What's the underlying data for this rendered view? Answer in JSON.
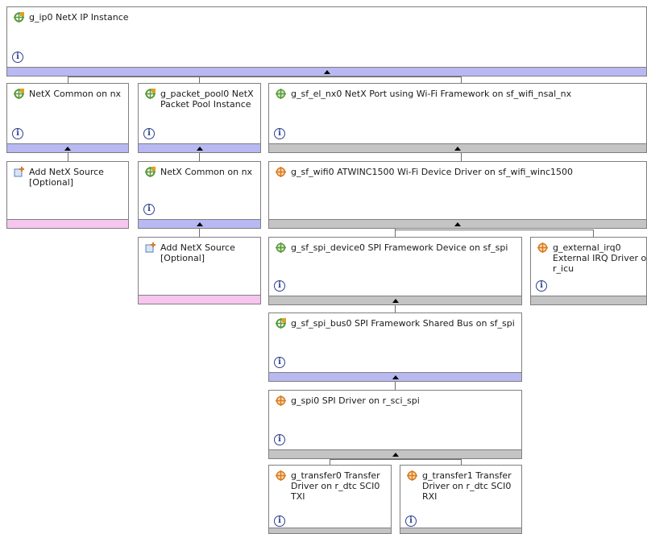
{
  "colors": {
    "bar_purple": "#b8b8f2",
    "bar_gray": "#c4c4c4",
    "bar_pink": "#f7c6ee",
    "icon_green": "#5a9a3a",
    "icon_orange": "#d97a1c",
    "info_blue": "#2d3f8f"
  },
  "modules": {
    "ip0": {
      "title": "g_ip0 NetX IP Instance",
      "icon": "module-green-gear-icon"
    },
    "nx_common_1": {
      "title": "NetX Common on nx",
      "icon": "module-green-gear-icon"
    },
    "add_source_1": {
      "title": "Add NetX Source\n[Optional]",
      "icon": "add-component-icon"
    },
    "packet_pool0": {
      "title": "g_packet_pool0 NetX\nPacket Pool Instance",
      "icon": "module-green-gear-icon"
    },
    "nx_common_2": {
      "title": "NetX Common on nx",
      "icon": "module-green-gear-icon"
    },
    "add_source_2": {
      "title": "Add NetX Source\n[Optional]",
      "icon": "add-component-icon"
    },
    "sf_el_nx0": {
      "title": "g_sf_el_nx0 NetX Port using Wi-Fi Framework on sf_wifi_nsal_nx",
      "icon": "module-green-crosshair-icon"
    },
    "sf_wifi0": {
      "title": "g_sf_wifi0 ATWINC1500 Wi-Fi Device Driver on sf_wifi_winc1500",
      "icon": "module-orange-crosshair-icon"
    },
    "spi_device0": {
      "title": "g_sf_spi_device0 SPI Framework Device on sf_spi",
      "icon": "module-green-crosshair-icon"
    },
    "external_irq0": {
      "title": "g_external_irq0\nExternal IRQ Driver on\nr_icu",
      "icon": "module-orange-crosshair-icon"
    },
    "spi_bus0": {
      "title": "g_sf_spi_bus0 SPI Framework Shared Bus on sf_spi",
      "icon": "module-green-gear-icon"
    },
    "spi0": {
      "title": "g_spi0 SPI Driver on r_sci_spi",
      "icon": "module-orange-crosshair-icon"
    },
    "transfer0": {
      "title": "g_transfer0 Transfer\nDriver on r_dtc SCI0\nTXI",
      "icon": "module-orange-crosshair-icon"
    },
    "transfer1": {
      "title": "g_transfer1 Transfer\nDriver on r_dtc SCI0\nRXI",
      "icon": "module-orange-crosshair-icon"
    }
  }
}
